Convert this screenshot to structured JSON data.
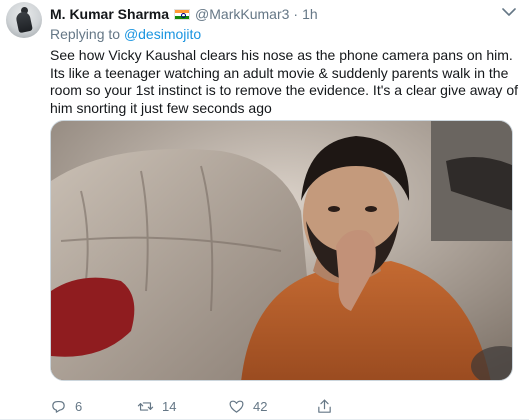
{
  "tweet": {
    "name": "M. Kumar Sharma",
    "handle": "@MarkKumar3",
    "separator": "·",
    "time": "1h",
    "replying_prefix": "Replying to",
    "replying_to": "@desimojito",
    "text": "See how Vicky Kaushal clears his nose as the phone camera pans on him. Its like a teenager watching an adult movie & suddenly parents walk in the room so your 1st instinct is to remove the evidence. It's a clear give away of him snorting it just few seconds ago",
    "actions": {
      "reply_count": "6",
      "retweet_count": "14",
      "like_count": "42"
    },
    "icons": [
      "reply-icon",
      "retweet-icon",
      "like-icon",
      "share-icon",
      "chevron-down-icon",
      "india-flag-icon"
    ],
    "colors": {
      "link": "#1b95e0",
      "secondary": "#657786",
      "text": "#14171a"
    }
  }
}
